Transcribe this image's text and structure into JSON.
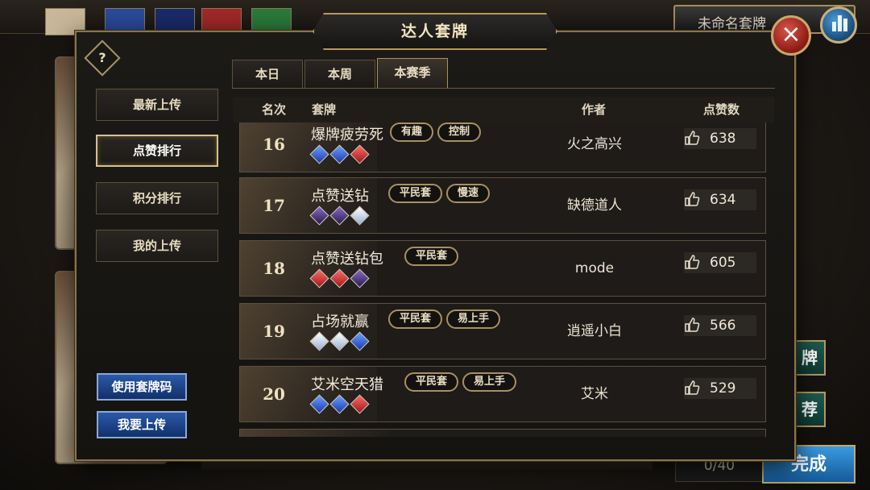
{
  "title": "达人套牌",
  "help_icon": "?",
  "close_icon": "×",
  "background": {
    "deck_name": "未命名套牌",
    "card_count": "0/40",
    "done_label": "完成",
    "side_buttons": [
      "牌",
      "荐"
    ]
  },
  "sidebar": {
    "items": [
      {
        "label": "最新上传",
        "active": false
      },
      {
        "label": "点赞排行",
        "active": true
      },
      {
        "label": "积分排行",
        "active": false
      },
      {
        "label": "我的上传",
        "active": false
      }
    ],
    "use_code_label": "使用套牌码",
    "upload_label": "我要上传"
  },
  "tabs": [
    {
      "label": "本日",
      "active": false
    },
    {
      "label": "本周",
      "active": false
    },
    {
      "label": "本赛季",
      "active": true
    }
  ],
  "columns": {
    "rank": "名次",
    "deck": "套牌",
    "author": "作者",
    "likes": "点赞数"
  },
  "rows": [
    {
      "rank": "16",
      "name": "爆牌疲劳死",
      "tags": [
        "有趣",
        "控制"
      ],
      "gems": [
        "blue",
        "blue",
        "red"
      ],
      "author": "火之高兴",
      "likes": "638"
    },
    {
      "rank": "17",
      "name": "点赞送钻",
      "tags": [
        "平民套",
        "慢速"
      ],
      "gems": [
        "purple",
        "purple",
        "white"
      ],
      "author": "缺德道人",
      "likes": "634"
    },
    {
      "rank": "18",
      "name": "点赞送钻包",
      "tags": [
        "平民套"
      ],
      "gems": [
        "red",
        "red",
        "purple"
      ],
      "author": "mode",
      "likes": "605"
    },
    {
      "rank": "19",
      "name": "占场就赢",
      "tags": [
        "平民套",
        "易上手"
      ],
      "gems": [
        "white",
        "white",
        "blue"
      ],
      "author": "逍遥小白",
      "likes": "566"
    },
    {
      "rank": "20",
      "name": "艾米空天猎",
      "tags": [
        "平民套",
        "易上手"
      ],
      "gems": [
        "blue",
        "blue",
        "red"
      ],
      "author": "艾米",
      "likes": "529"
    }
  ]
}
